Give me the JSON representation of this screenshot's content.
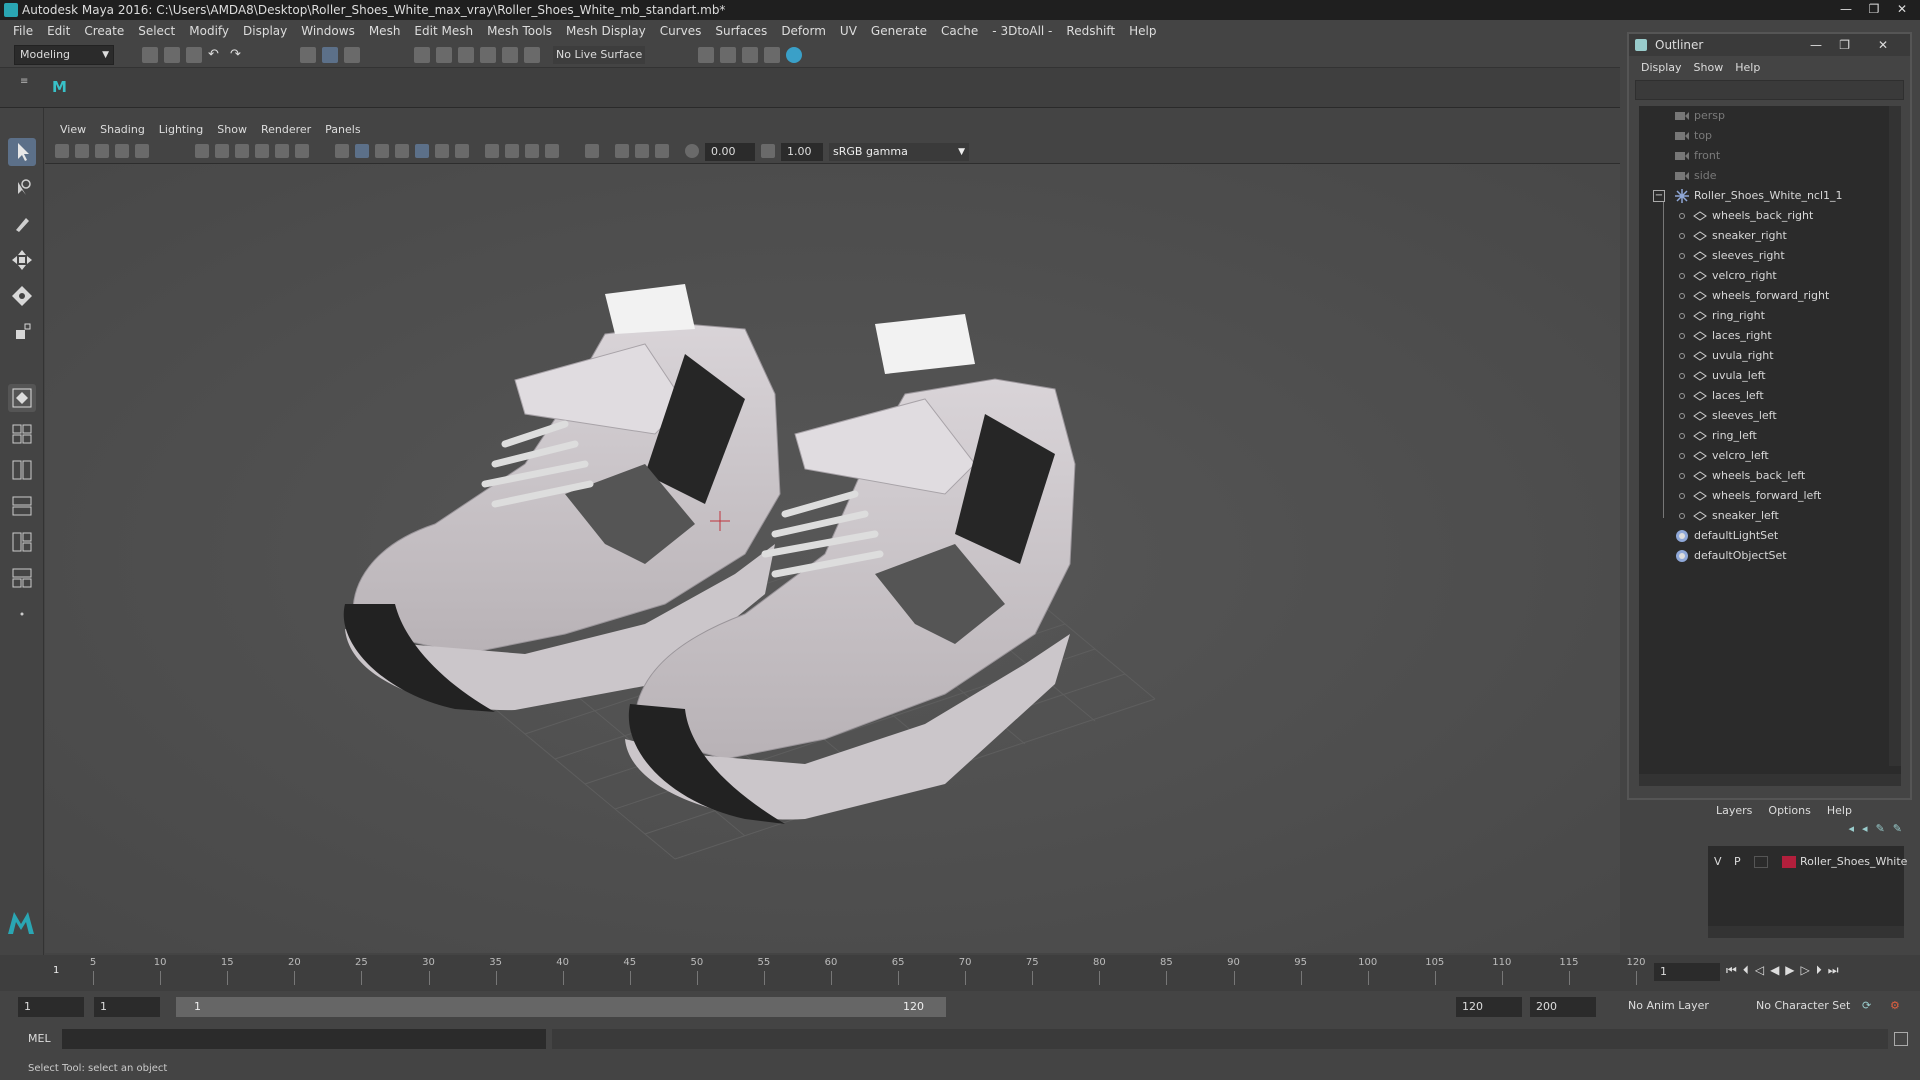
{
  "window": {
    "title": "Autodesk Maya 2016: C:\\Users\\AMDA8\\Desktop\\Roller_Shoes_White_max_vray\\Roller_Shoes_White_mb_standart.mb*",
    "controls": [
      "—",
      "❐",
      "✕"
    ]
  },
  "menubar": [
    "File",
    "Edit",
    "Create",
    "Select",
    "Modify",
    "Display",
    "Windows",
    "Mesh",
    "Edit Mesh",
    "Mesh Tools",
    "Mesh Display",
    "Curves",
    "Surfaces",
    "Deform",
    "UV",
    "Generate",
    "Cache",
    "- 3DtoAll -",
    "Redshift",
    "Help"
  ],
  "statusline": {
    "mode": "Modeling",
    "live_surface": "No Live Surface"
  },
  "viewport": {
    "menu": [
      "View",
      "Shading",
      "Lighting",
      "Show",
      "Renderer",
      "Panels"
    ],
    "exposure": "0.00",
    "gamma_value": "1.00",
    "color_space": "sRGB gamma",
    "camera": "persp"
  },
  "outliner": {
    "title": "Outliner",
    "menu": [
      "Display",
      "Show",
      "Help"
    ],
    "cameras": [
      "persp",
      "top",
      "front",
      "side"
    ],
    "group": "Roller_Shoes_White_ncl1_1",
    "children": [
      "wheels_back_right",
      "sneaker_right",
      "sleeves_right",
      "velcro_right",
      "wheels_forward_right",
      "ring_right",
      "laces_right",
      "uvula_right",
      "uvula_left",
      "laces_left",
      "sleeves_left",
      "ring_left",
      "velcro_left",
      "wheels_back_left",
      "wheels_forward_left",
      "sneaker_left"
    ],
    "sets": [
      "defaultLightSet",
      "defaultObjectSet"
    ]
  },
  "layers": {
    "menu": [
      "Layers",
      "Options",
      "Help"
    ],
    "visible": "V",
    "playback": "P",
    "layer_name": "Roller_Shoes_White",
    "layer_color": "#b21f3c"
  },
  "timeslider": {
    "ticks": [
      "5",
      "10",
      "15",
      "20",
      "25",
      "30",
      "35",
      "40",
      "45",
      "50",
      "55",
      "60",
      "65",
      "70",
      "75",
      "80",
      "85",
      "90",
      "95",
      "100",
      "105",
      "110",
      "115",
      "120"
    ],
    "current_marker": "1",
    "current_frame": "1"
  },
  "range": {
    "start": "1",
    "playback_start": "1",
    "slider_start": "1",
    "slider_end": "120",
    "playback_end": "120",
    "end": "200",
    "anim_layer": "No Anim Layer",
    "character_set": "No Character Set"
  },
  "command": {
    "label": "MEL"
  },
  "help": "Select Tool: select an object"
}
